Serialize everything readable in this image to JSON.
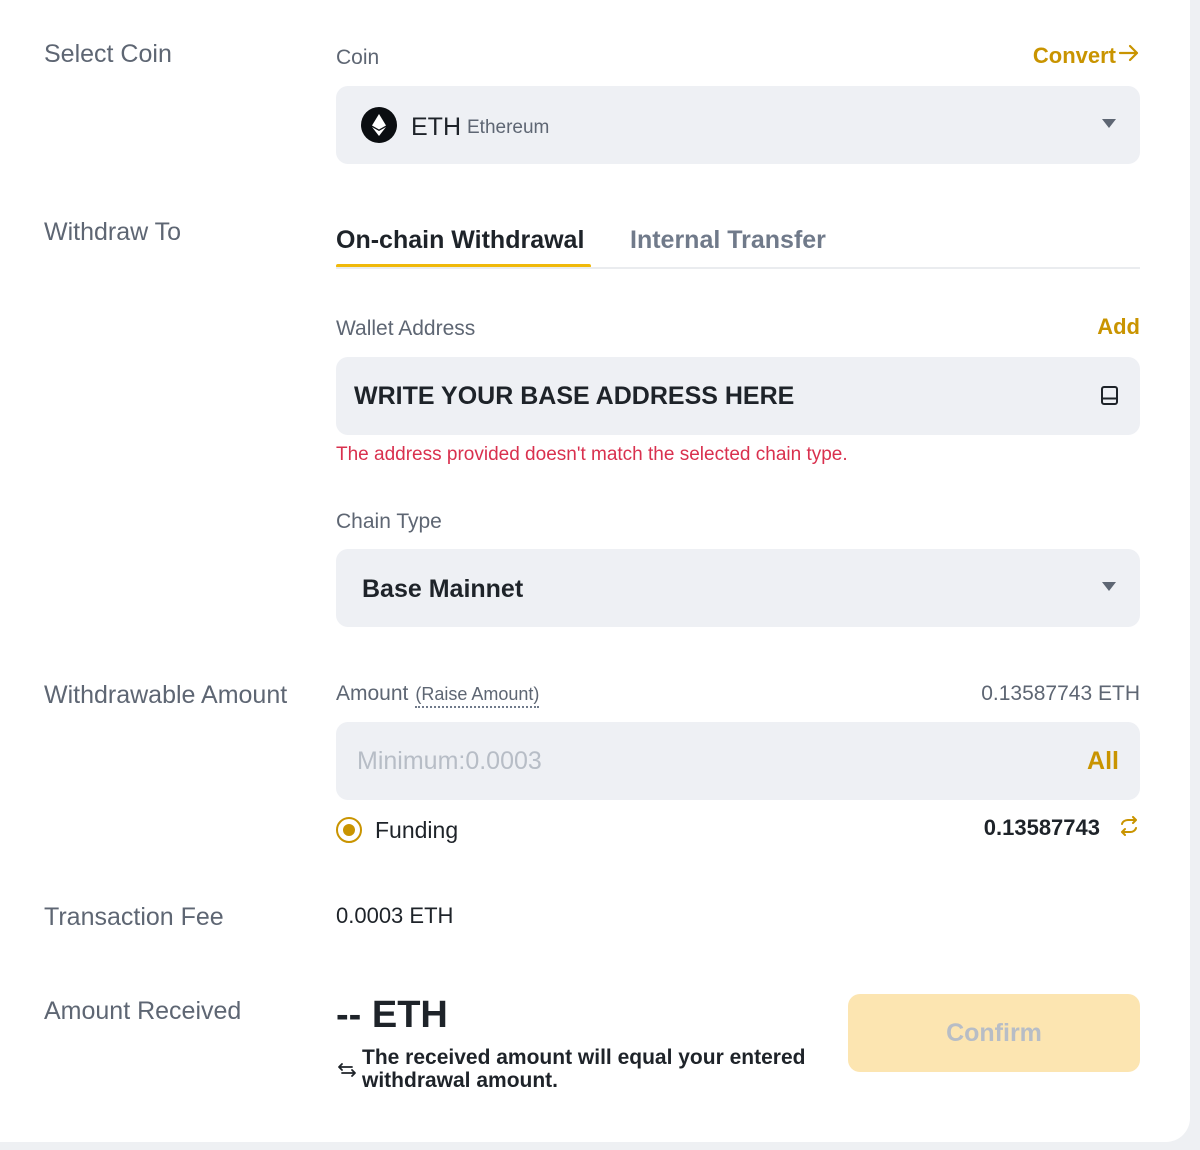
{
  "labels": {
    "select_coin": "Select Coin",
    "withdraw_to": "Withdraw To",
    "withdrawable_amount": "Withdrawable Amount",
    "transaction_fee": "Transaction Fee",
    "amount_received": "Amount Received"
  },
  "coin": {
    "label": "Coin",
    "convert": "Convert",
    "symbol": "ETH",
    "name": "Ethereum"
  },
  "tabs": [
    {
      "label": "On-chain Withdrawal",
      "active": true
    },
    {
      "label": "Internal Transfer",
      "active": false
    }
  ],
  "wallet": {
    "label": "Wallet Address",
    "add": "Add",
    "value": "WRITE YOUR BASE ADDRESS HERE",
    "error": "The address provided doesn't match the selected chain type."
  },
  "chain": {
    "label": "Chain Type",
    "value": "Base Mainnet"
  },
  "amount": {
    "label": "Amount",
    "raise": "(Raise Amount)",
    "available": "0.13587743 ETH",
    "placeholder": "Minimum:0.0003",
    "all": "All",
    "source_label": "Funding",
    "source_balance": "0.13587743"
  },
  "fee": {
    "value": "0.0003 ETH"
  },
  "received": {
    "value": "-- ETH",
    "note": "The received amount will equal your entered withdrawal amount."
  },
  "confirm": {
    "label": "Confirm"
  },
  "colors": {
    "accent": "#f0b90b",
    "link": "#c99400",
    "error": "#d9304e",
    "confirm_bg": "#fce5b1",
    "confirm_text": "#b7bdc6"
  }
}
